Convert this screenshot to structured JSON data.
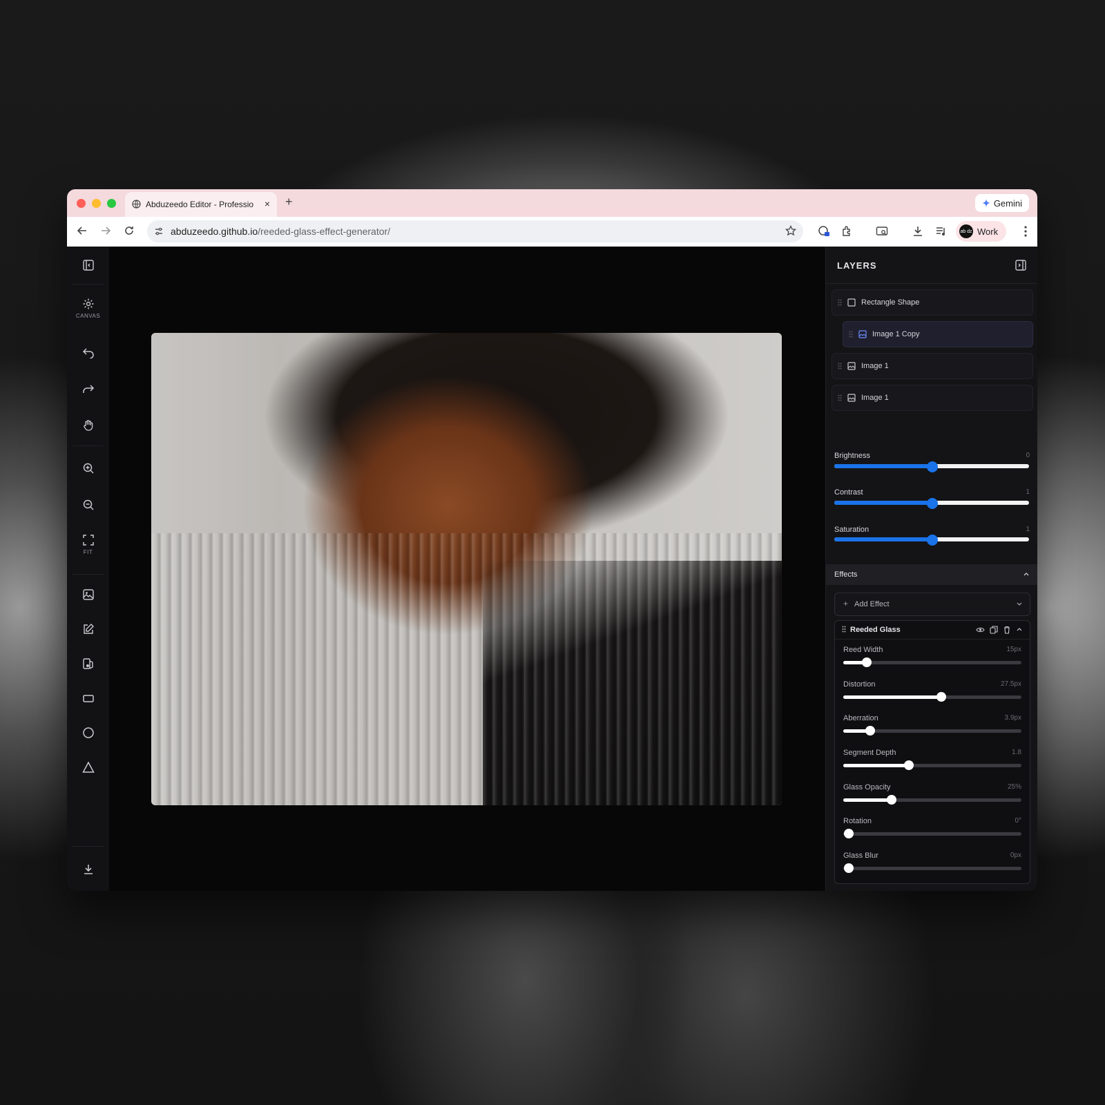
{
  "browser": {
    "tab_title": "Abduzeedo Editor - Professio",
    "tab_close": "×",
    "new_tab": "+",
    "gemini_label": "Gemini",
    "url_host": "abduzeedo.github.io",
    "url_path": "/reeded-glass-effect-generator/",
    "profile_label": "Work",
    "profile_avatar": "ab dz"
  },
  "left_toolbar": {
    "canvas_label": "CANVAS",
    "fit_label": "FIT",
    "icons": [
      "sidebar-toggle-icon",
      "gear-icon",
      "undo-icon",
      "redo-icon",
      "hand-icon",
      "zoom-in-icon",
      "zoom-out-icon",
      "fit-icon",
      "image-icon",
      "edit-icon",
      "layers-icon",
      "rectangle-icon",
      "circle-icon",
      "triangle-icon",
      "download-icon"
    ]
  },
  "layers_panel": {
    "title": "LAYERS",
    "layers": [
      {
        "name": "Rectangle Shape",
        "icon": "square-icon"
      },
      {
        "name": "Image 1 Copy",
        "icon": "image-icon"
      },
      {
        "name": "Image 1",
        "icon": "image-icon"
      },
      {
        "name": "Image 1",
        "icon": "image-icon"
      }
    ]
  },
  "adjustments": [
    {
      "label": "Brightness",
      "value": "0",
      "fraction": 0.5
    },
    {
      "label": "Contrast",
      "value": "1",
      "fraction": 0.5
    },
    {
      "label": "Saturation",
      "value": "1",
      "fraction": 0.5
    }
  ],
  "effects": {
    "title": "Effects",
    "add_effect": "Add Effect",
    "add_plus": "+",
    "card_title": "Reeded Glass",
    "params": [
      {
        "label": "Reed Width",
        "value": "15px",
        "fraction": 0.13
      },
      {
        "label": "Distortion",
        "value": "27.5px",
        "fraction": 0.55
      },
      {
        "label": "Aberration",
        "value": "3.9px",
        "fraction": 0.15
      },
      {
        "label": "Segment Depth",
        "value": "1.8",
        "fraction": 0.37
      },
      {
        "label": "Glass Opacity",
        "value": "25%",
        "fraction": 0.27
      },
      {
        "label": "Rotation",
        "value": "0°",
        "fraction": 0.0
      },
      {
        "label": "Glass Blur",
        "value": "0px",
        "fraction": 0.0
      }
    ]
  },
  "colors": {
    "accent": "#1a73e8",
    "panel": "#141416",
    "canvas": "#070708"
  }
}
